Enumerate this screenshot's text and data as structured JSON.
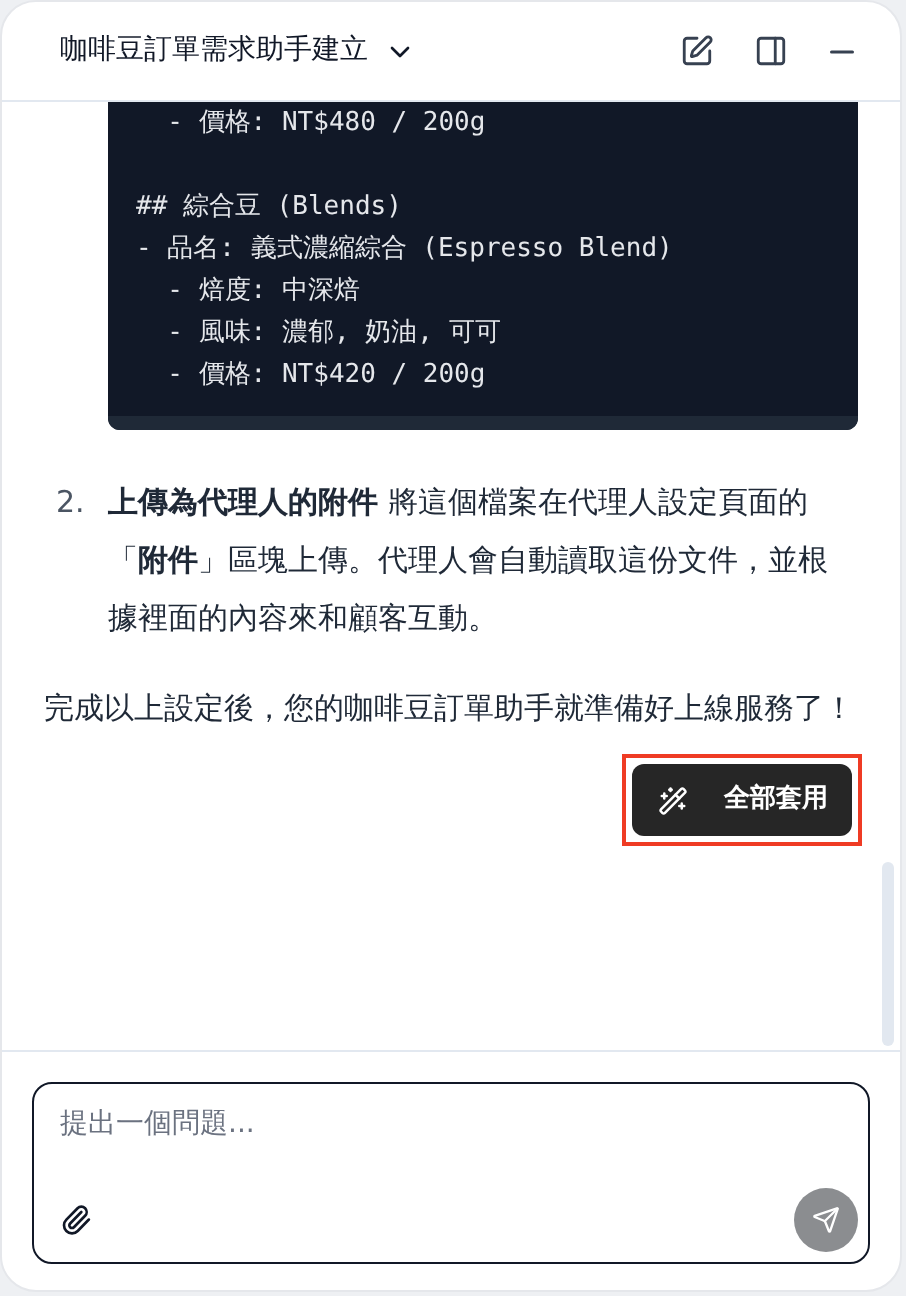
{
  "header": {
    "title": "咖啡豆訂單需求助手建立"
  },
  "code_block": {
    "sections": [
      [
        "  - 價格: NT$480 / 200g"
      ],
      [
        "## 綜合豆 (Blends)",
        "- 品名: 義式濃縮綜合 (Espresso Blend)",
        "  - 焙度: 中深焙",
        "  - 風味: 濃郁, 奶油, 可可",
        "  - 價格: NT$420 / 200g"
      ]
    ]
  },
  "list_items": [
    {
      "number": "2.",
      "text": "**上傳為代理人的附件** 將這個檔案在代理人設定頁面的「**附件**」區塊上傳。代理人會自動讀取這份文件，並根據裡面的內容來和顧客互動。"
    }
  ],
  "paragraph": "完成以上設定後，您的咖啡豆訂單助手就準備好上線服務了！",
  "apply_button": {
    "label": "全部套用",
    "highlighted": true
  },
  "composer": {
    "placeholder": "提出一個問題..."
  }
}
